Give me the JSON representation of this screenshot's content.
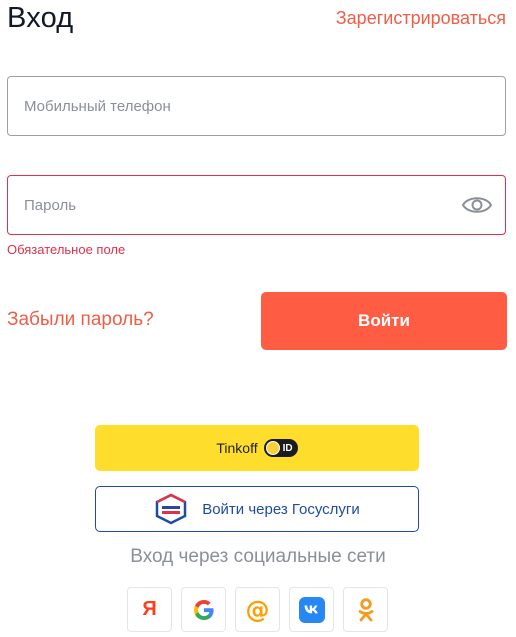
{
  "header": {
    "title": "Вход",
    "register_link": "Зарегистрироваться"
  },
  "form": {
    "phone_placeholder": "Мобильный телефон",
    "password_placeholder": "Пароль",
    "password_error": "Обязательное поле",
    "forgot_password": "Забыли пароль?",
    "login_button": "Войти"
  },
  "alt_login": {
    "tinkoff_label": "Tinkoff",
    "tinkoff_badge": "ID",
    "gosuslugi_label": "Войти через Госуслуги"
  },
  "social": {
    "caption": "Вход через социальные сети",
    "providers": [
      "yandex-icon",
      "google-icon",
      "mailru-icon",
      "vk-icon",
      "odnoklassniki-icon"
    ],
    "yandex_letter": "Я"
  },
  "colors": {
    "accent": "#fe5c43",
    "link": "#f05d46",
    "error": "#e0304a",
    "tinkoff_yellow": "#ffdd2d",
    "gosuslugi_blue": "#1f4ba0"
  }
}
